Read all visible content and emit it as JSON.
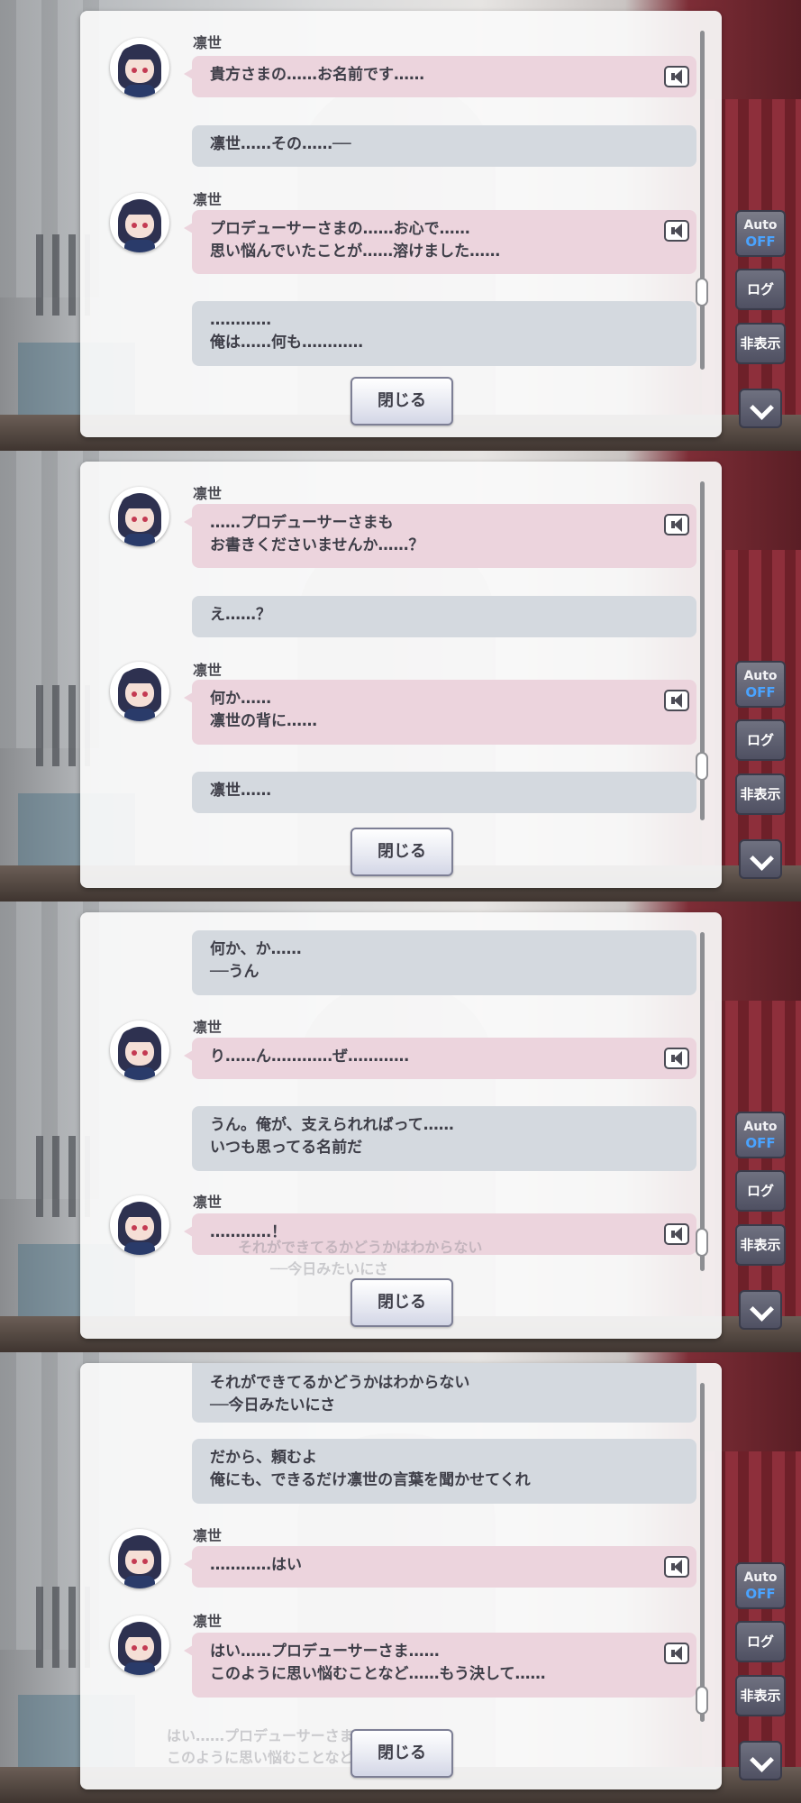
{
  "ui": {
    "close_label": "閉じる",
    "auto_label": "Auto",
    "auto_state": "OFF",
    "log_label": "ログ",
    "hide_label": "非表示",
    "speaker_icon": "speaker-icon",
    "down_icon": "chevron-down-icon",
    "colors": {
      "idol_bubble": "#ecd4dd",
      "producer_bubble": "#d4d9df",
      "auto_off": "#4aa3ff"
    }
  },
  "background_text": {
    "line1": "それができてるかどうかはわからない",
    "line2": "──今日みたいにさ",
    "badge": "OFF"
  },
  "panels": [
    {
      "messages": [
        {
          "type": "idol",
          "name": "凛世",
          "lines": [
            "貴方さまの……お名前です……"
          ]
        },
        {
          "type": "producer",
          "lines": [
            "凛世……その……──"
          ]
        },
        {
          "type": "idol",
          "name": "凛世",
          "lines": [
            "プロデューサーさまの……お心で……",
            "思い悩んでいたことが……溶けました……"
          ]
        },
        {
          "type": "producer",
          "lines": [
            "…………",
            "俺は……何も…………"
          ]
        }
      ]
    },
    {
      "messages": [
        {
          "type": "idol",
          "name": "凛世",
          "lines": [
            "……プロデューサーさまも",
            "お書きくださいませんか……？"
          ]
        },
        {
          "type": "producer",
          "lines": [
            "え……？"
          ]
        },
        {
          "type": "idol",
          "name": "凛世",
          "lines": [
            "何か……",
            "凛世の背に……"
          ]
        },
        {
          "type": "producer",
          "lines": [
            "凛世……"
          ]
        }
      ]
    },
    {
      "messages": [
        {
          "type": "producer",
          "lines": [
            "何か、か……",
            "──うん"
          ]
        },
        {
          "type": "idol",
          "name": "凛世",
          "lines": [
            "り……ん…………ぜ…………"
          ]
        },
        {
          "type": "producer",
          "lines": [
            "うん。俺が、支えられればって……",
            "いつも思ってる名前だ"
          ]
        },
        {
          "type": "idol",
          "name": "凛世",
          "lines": [
            "…………！"
          ]
        }
      ]
    },
    {
      "messages": [
        {
          "type": "producer",
          "lines": [
            "それができてるかどうかはわからない",
            "──今日みたいにさ"
          ]
        },
        {
          "type": "producer",
          "lines": [
            "だから、頼むよ",
            "俺にも、できるだけ凛世の言葉を聞かせてくれ"
          ]
        },
        {
          "type": "idol",
          "name": "凛世",
          "lines": [
            "…………はい"
          ]
        },
        {
          "type": "idol",
          "name": "凛世",
          "lines": [
            "はい……プロデューサーさま……",
            "このように思い悩むことなど……もう決して……"
          ]
        }
      ],
      "ghost_lines": [
        "はい……プロデューサーさま……",
        "このように思い悩むことなど……"
      ]
    }
  ]
}
